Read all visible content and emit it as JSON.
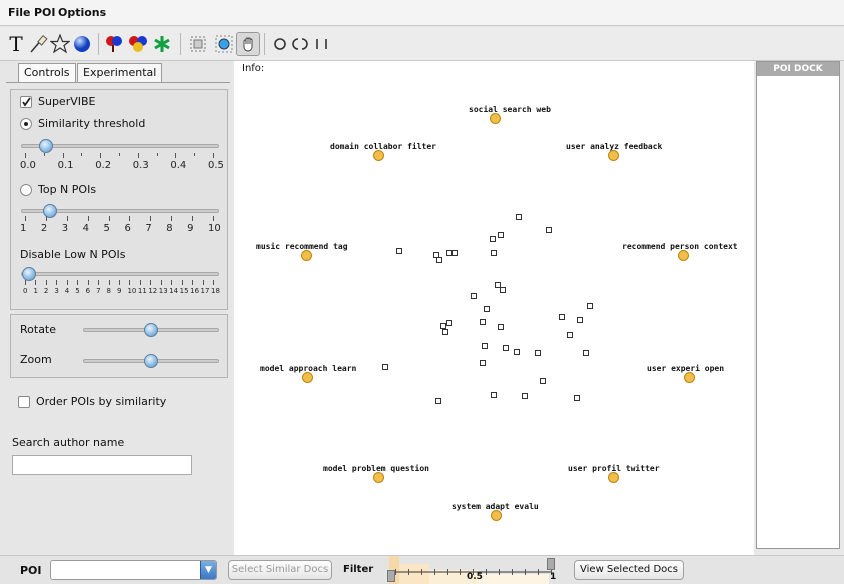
{
  "menu": {
    "file": "File",
    "poi": "POI",
    "options": "Options"
  },
  "toolbar": {
    "icons": [
      "text-icon",
      "pen-icon",
      "star-icon",
      "sphere-icon",
      "hearts-icon",
      "heart-cluster-icon",
      "green-star-icon",
      "select-box-icon",
      "target-icon",
      "hand-icon",
      "circle-icon",
      "open-circle-icon",
      "bars-icon"
    ]
  },
  "tabs": {
    "controls": "Controls",
    "experimental": "Experimental"
  },
  "controls": {
    "supervibe_label": "SuperVIBE",
    "supervibe_checked": true,
    "similarity_label": "Similarity threshold",
    "similarity_selected": true,
    "similarity_ticks": [
      "0.0",
      "0.1",
      "0.2",
      "0.3",
      "0.4",
      "0.5"
    ],
    "similarity_value": 0.05,
    "topn_label": "Top N POIs",
    "topn_ticks": [
      "1",
      "2",
      "3",
      "4",
      "5",
      "6",
      "7",
      "8",
      "9",
      "10"
    ],
    "topn_value": 2,
    "disable_label": "Disable Low N POIs",
    "disable_ticks": [
      "0",
      "1",
      "2",
      "3",
      "4",
      "5",
      "6",
      "7",
      "8",
      "9",
      "10",
      "11",
      "12",
      "13",
      "14",
      "15",
      "16",
      "17",
      "18"
    ],
    "disable_value": 0,
    "rotate_label": "Rotate",
    "rotate_value": 0.5,
    "zoom_label": "Zoom",
    "zoom_value": 0.5,
    "order_label": "Order POIs by similarity",
    "order_checked": false,
    "search_label": "Search author name",
    "search_value": ""
  },
  "canvas": {
    "info_label": "Info:",
    "pois": [
      "social  search  web",
      "domain  collabor  filter",
      "user  analyz  feedback",
      "music  recommend  tag",
      "recommend  person  context",
      "model  approach  learn",
      "user  experi  open",
      "model  problem  question",
      "user  profil  twitter",
      "system  adapt  evalu"
    ],
    "poi_color": "#f3bd4b"
  },
  "dock": {
    "title": "POI DOCK"
  },
  "bottom": {
    "poi_label": "POI",
    "poi_select_value": "",
    "similar_button": "Select Similar Docs",
    "filter_label": "Filter",
    "filter_tick_label": "0.5",
    "filter_end_label": "1",
    "view_button": "View Selected Docs"
  }
}
